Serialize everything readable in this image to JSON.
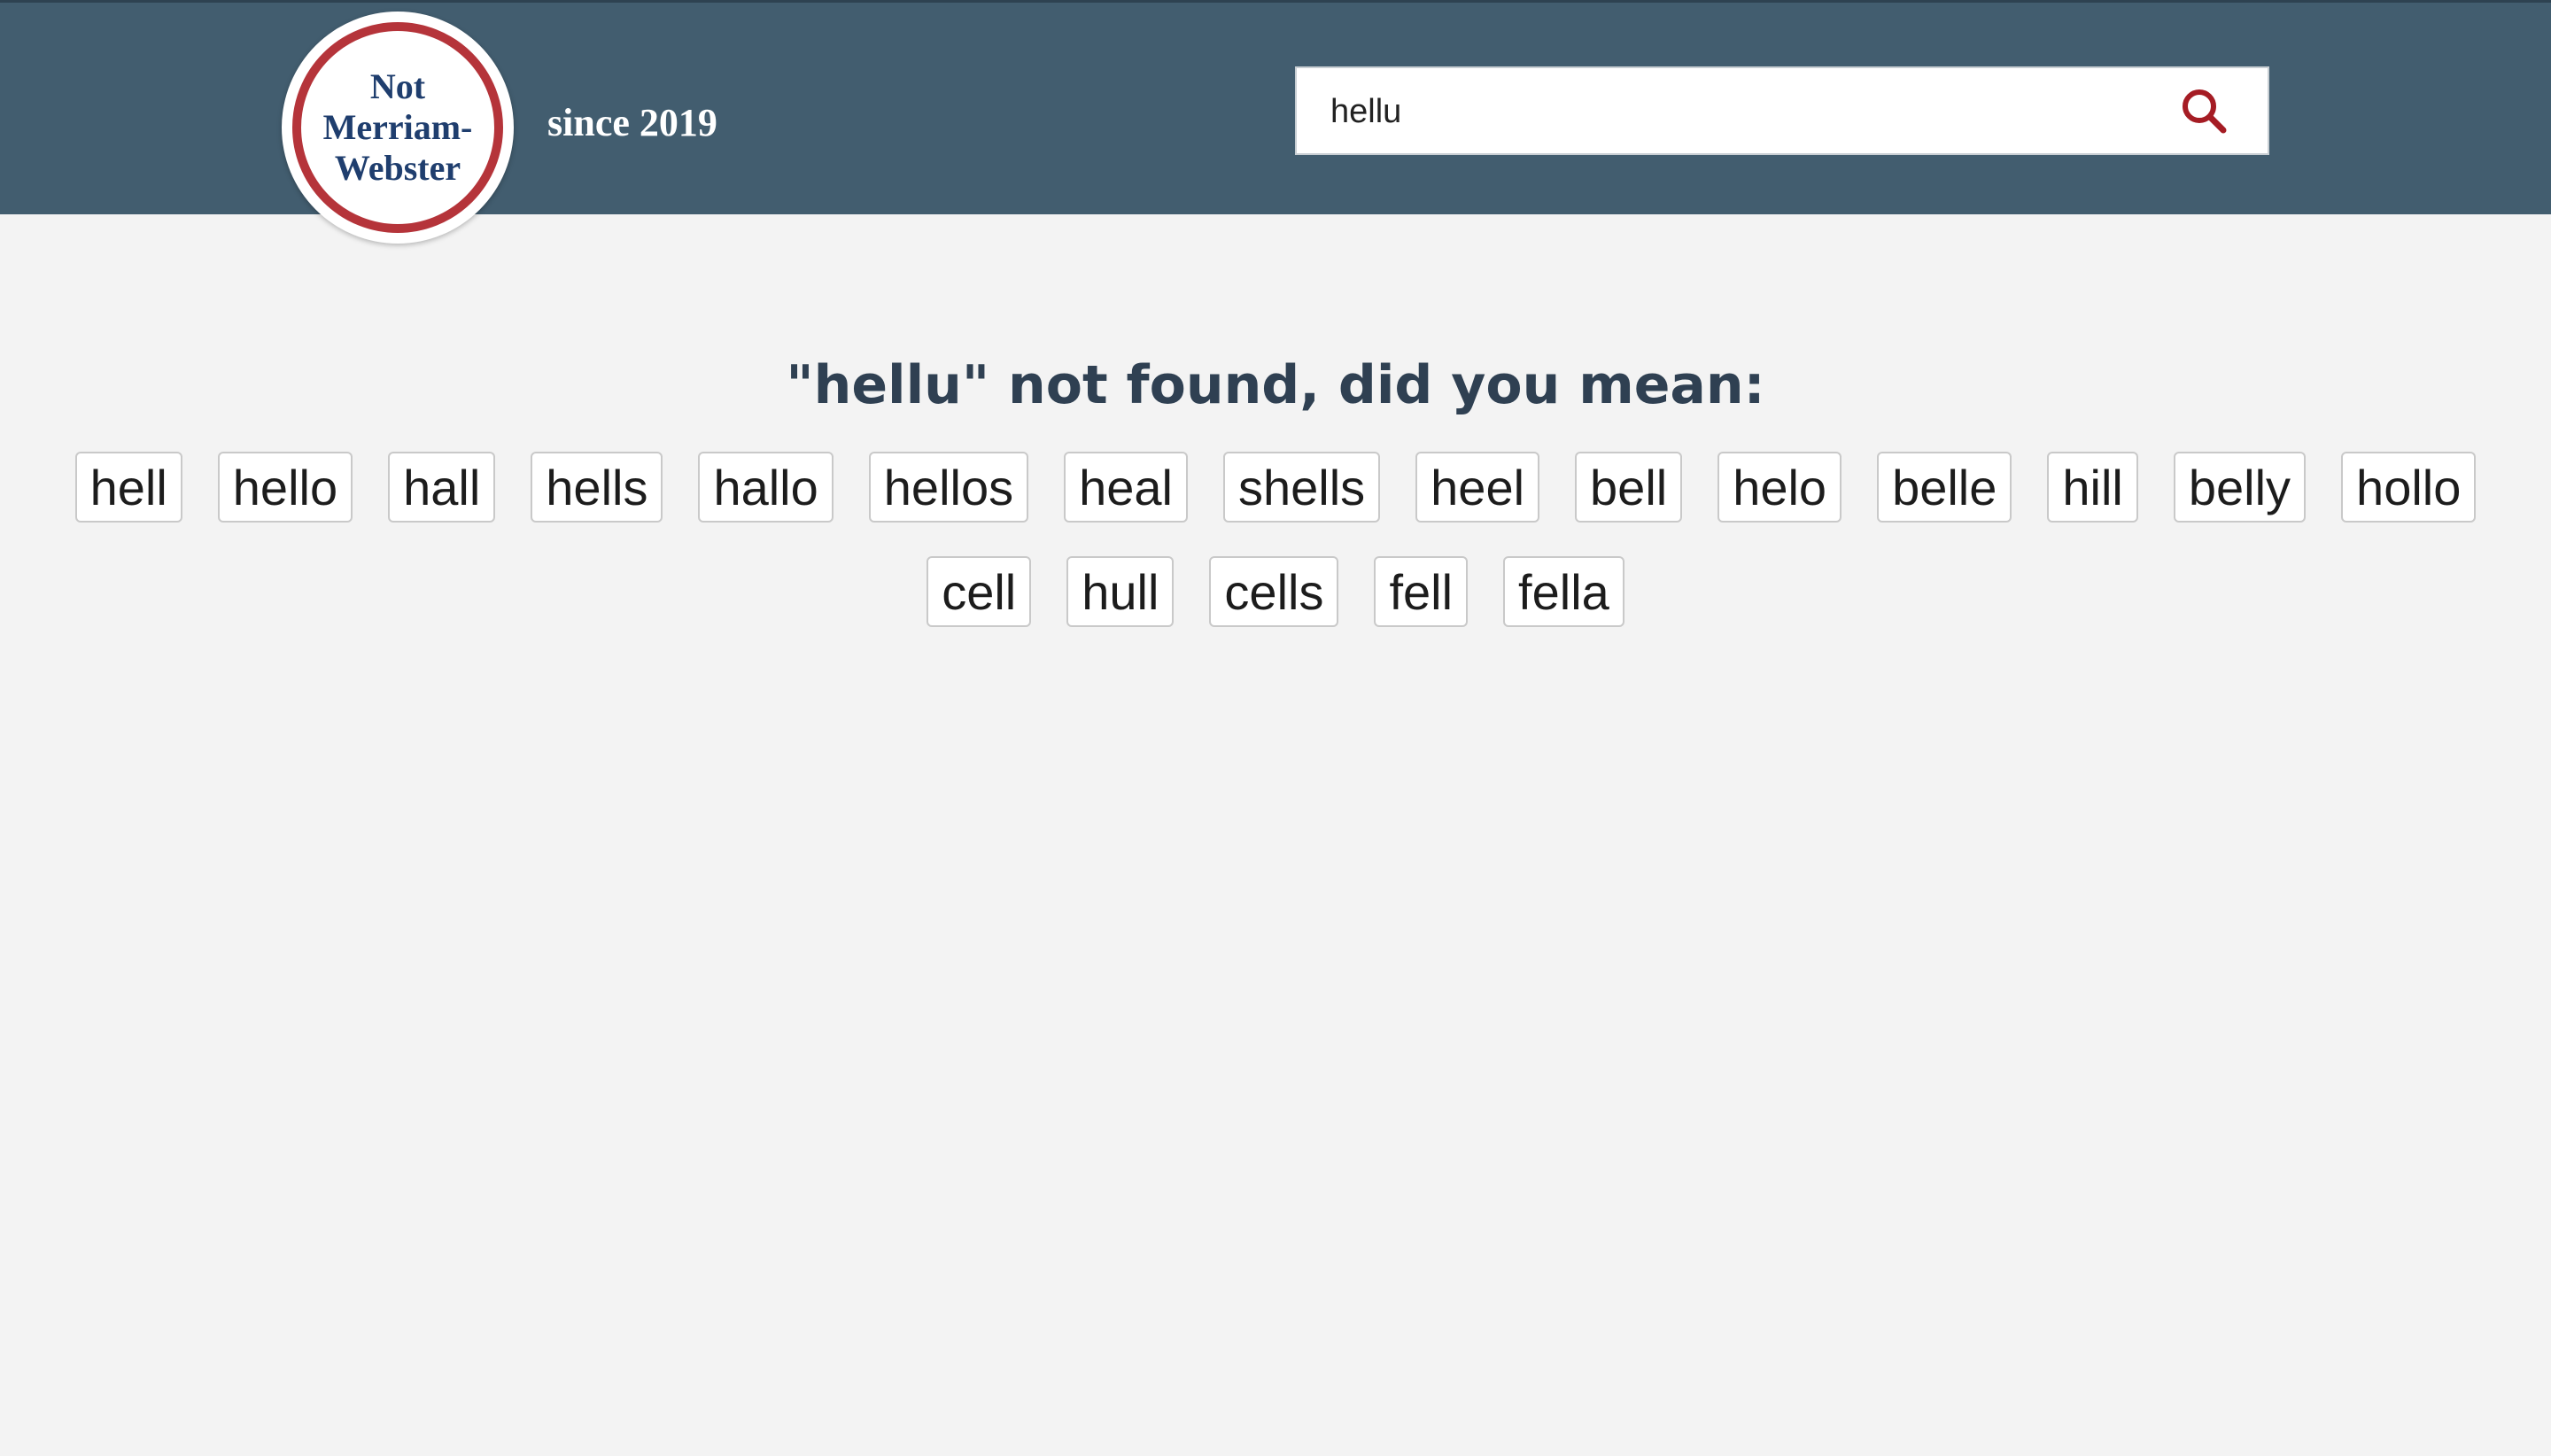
{
  "header": {
    "logo_lines": [
      "Not",
      "Merriam-",
      "Webster"
    ],
    "tagline": "since 2019",
    "background_color": "#425d6f",
    "logo_ring_color": "#b5343a",
    "logo_text_color": "#1f3e6e"
  },
  "search": {
    "value": "hellu",
    "icon": "search-icon",
    "icon_color": "#a51c24"
  },
  "results": {
    "message": "\"hellu\" not found, did you mean:",
    "suggestions": [
      "hell",
      "hello",
      "hall",
      "hells",
      "hallo",
      "hellos",
      "heal",
      "shells",
      "heel",
      "bell",
      "helo",
      "belle",
      "hill",
      "belly",
      "hollo",
      "cell",
      "hull",
      "cells",
      "fell",
      "fella"
    ]
  }
}
